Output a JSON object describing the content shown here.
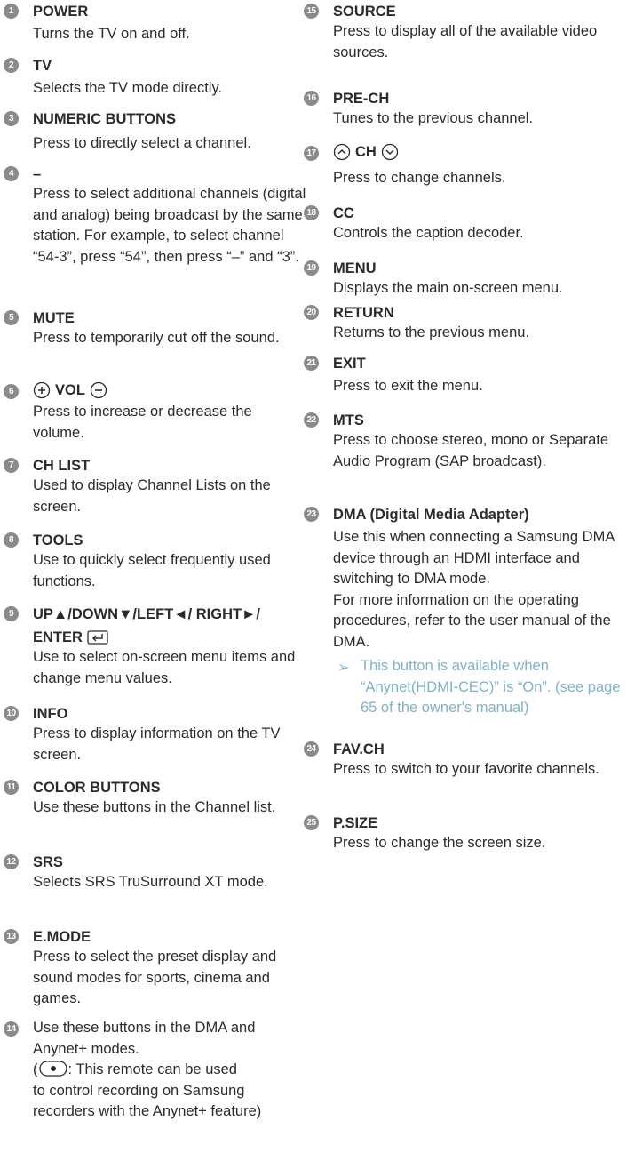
{
  "left_items": [
    {
      "num": "1",
      "title": "POWER",
      "desc": "Turns the TV on and off."
    },
    {
      "num": "2",
      "title": "TV",
      "desc": "Selects the TV mode directly."
    },
    {
      "num": "3",
      "title": "NUMERIC BUTTONS",
      "desc": "Press to directly select a channel."
    },
    {
      "num": "4",
      "title": "–",
      "desc": "Press to select additional channels (digital and analog) being broadcast by the same station. For example, to select channel “54-3”, press “54”, then press “–” and “3”."
    },
    {
      "num": "5",
      "title": "MUTE",
      "desc": "Press to temporarily cut off the sound."
    },
    {
      "num": "6",
      "title": "VOL",
      "desc": "Press to increase or decrease the volume."
    },
    {
      "num": "7",
      "title": "CH LIST",
      "desc": "Used to display Channel Lists on the screen."
    },
    {
      "num": "8",
      "title": "TOOLS",
      "desc": "Use to quickly select frequently used functions."
    },
    {
      "num": "9",
      "title_line1": "UP▲/DOWN▼/LEFT◄/ RIGHT►/",
      "title_line2": "ENTER",
      "desc": "Use to select on-screen menu items and change menu values."
    },
    {
      "num": "10",
      "title": "INFO",
      "desc": "Press to display information on the TV screen."
    },
    {
      "num": "11",
      "title": "COLOR BUTTONS",
      "desc": "Use these buttons in the Channel list."
    },
    {
      "num": "12",
      "title": "SRS",
      "desc": "Selects SRS TruSurround XT mode."
    },
    {
      "num": "13",
      "title": "E.MODE",
      "desc": "Press to select the preset display and sound modes for sports, cinema and games."
    },
    {
      "num": "14",
      "desc_line1": "Use these buttons in the DMA and",
      "desc_line2": "Anynet+ modes.",
      "desc_paren_open": "(",
      "desc_after_icon": ": This remote can be used",
      "desc_rest": "to control recording on Samsung recorders with the Anynet+ feature)"
    }
  ],
  "right_items": [
    {
      "num": "15",
      "title": "SOURCE",
      "desc": "Press to display all of the available video sources."
    },
    {
      "num": "16",
      "title": "PRE-CH",
      "desc": "Tunes to the previous channel."
    },
    {
      "num": "17",
      "title": "CH",
      "desc": "Press to change channels."
    },
    {
      "num": "18",
      "title": "CC",
      "desc": "Controls the caption decoder."
    },
    {
      "num": "19",
      "title": "MENU",
      "desc": "Displays the main on-screen menu."
    },
    {
      "num": "20",
      "title": "RETURN",
      "desc": "Returns to the previous menu."
    },
    {
      "num": "21",
      "title": "EXIT",
      "desc": "Press to exit the menu."
    },
    {
      "num": "22",
      "title": "MTS",
      "desc": "Press to choose stereo, mono or Separate Audio Program (SAP broadcast)."
    },
    {
      "num": "23",
      "title": "DMA (Digital Media Adapter)",
      "desc": "Use this when connecting a Samsung DMA device through an HDMI interface and switching to DMA mode.",
      "desc2": "For more information on the operating procedures, refer to the user manual of the DMA.",
      "note_arrow": "➢",
      "note": "This button is available when “Anynet(HDMI-CEC)” is “On”. (see page 65 of the owner's manual)"
    },
    {
      "num": "24",
      "title": "FAV.CH",
      "desc": "Press to switch to your favorite channels."
    },
    {
      "num": "25",
      "title": "P.SIZE",
      "desc": "Press to change the screen size."
    }
  ],
  "icons": {
    "vol_up": "plus-circle-icon",
    "vol_down": "minus-circle-icon",
    "ch_up": "chevron-up-circle-icon",
    "ch_down": "chevron-down-circle-icon",
    "enter": "enter-key-icon",
    "record": "record-button-icon",
    "note": "arrow-right-icon"
  },
  "colors": {
    "text": "#2b2b2b",
    "badge": "#8a8a8a",
    "note": "#7fb3c8"
  }
}
